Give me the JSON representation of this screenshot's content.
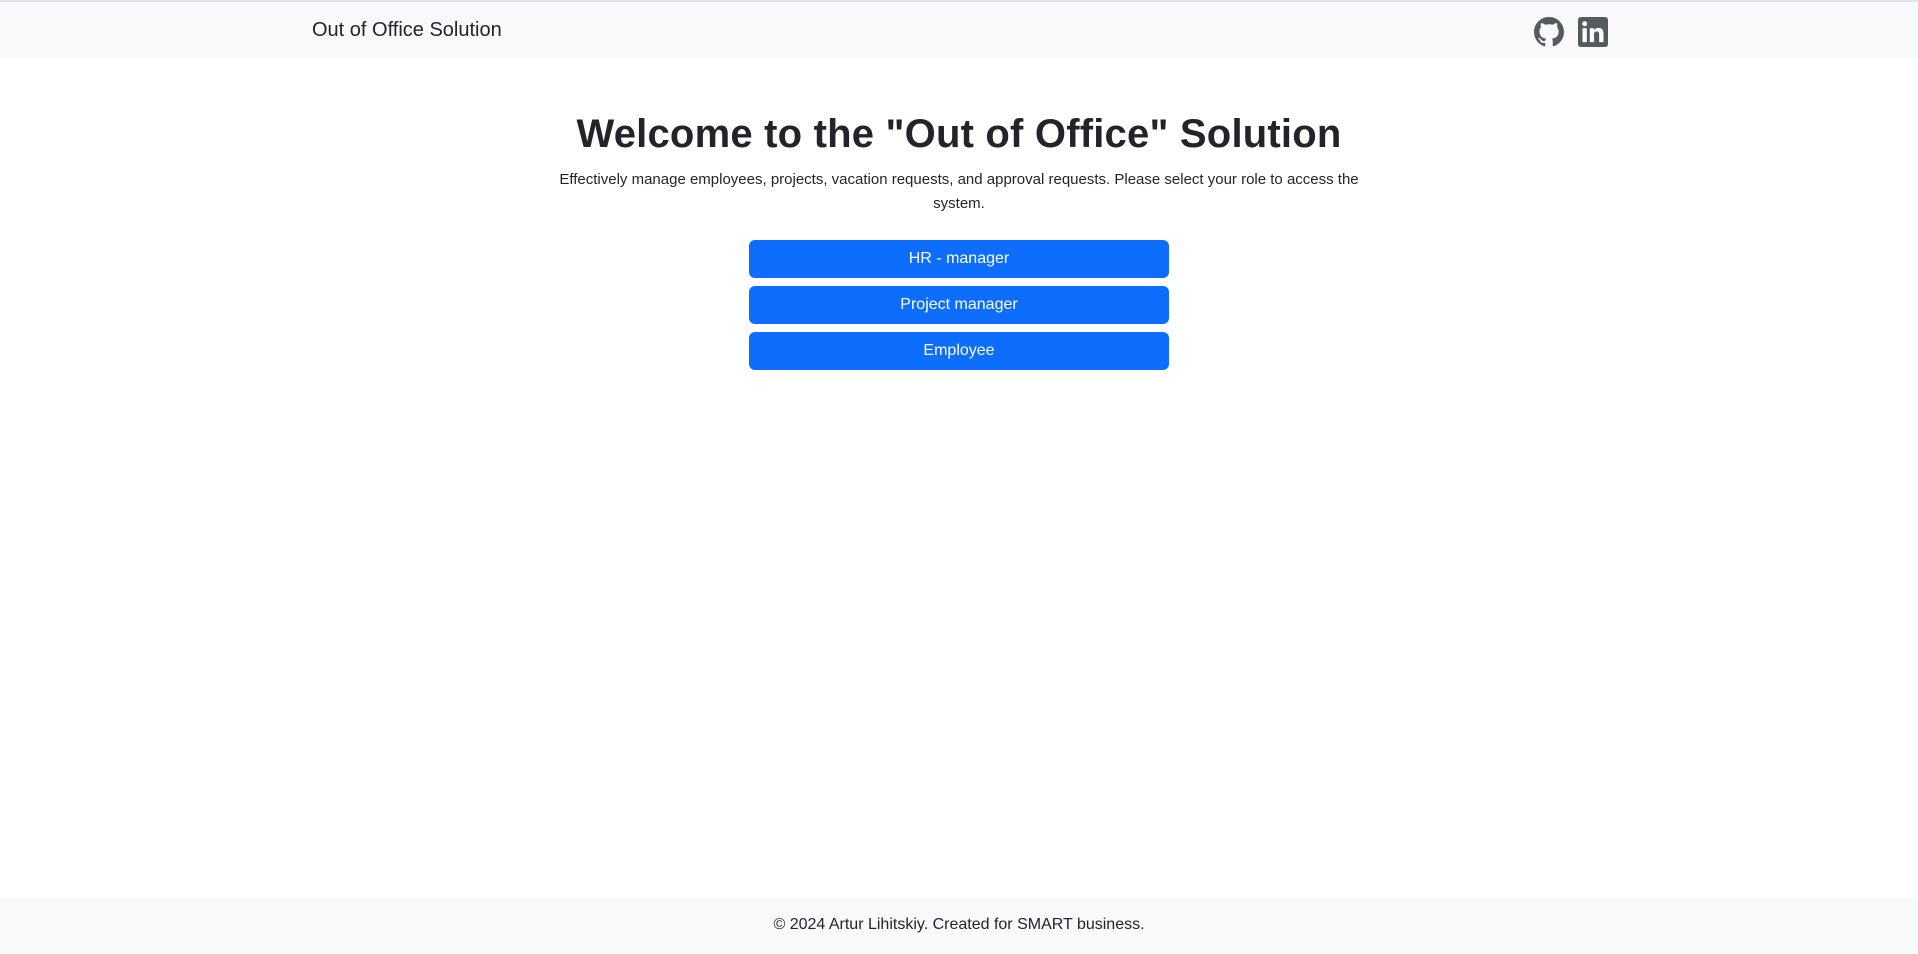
{
  "navbar": {
    "brand": "Out of Office Solution",
    "icons": [
      "github-icon",
      "linkedin-icon"
    ]
  },
  "main": {
    "title": "Welcome to the \"Out of Office\" Solution",
    "subtitle": "Effectively manage employees, projects, vacation requests, and approval requests. Please select your role to access the system.",
    "roles": [
      "HR - manager",
      "Project manager",
      "Employee"
    ]
  },
  "footer": {
    "text": "© 2024 Artur Lihitskiy. Created for SMART business."
  },
  "colors": {
    "primary": "#0d6efd",
    "navbar_bg": "#f8f9fa",
    "icon": "#555a5f",
    "text": "#212529"
  }
}
